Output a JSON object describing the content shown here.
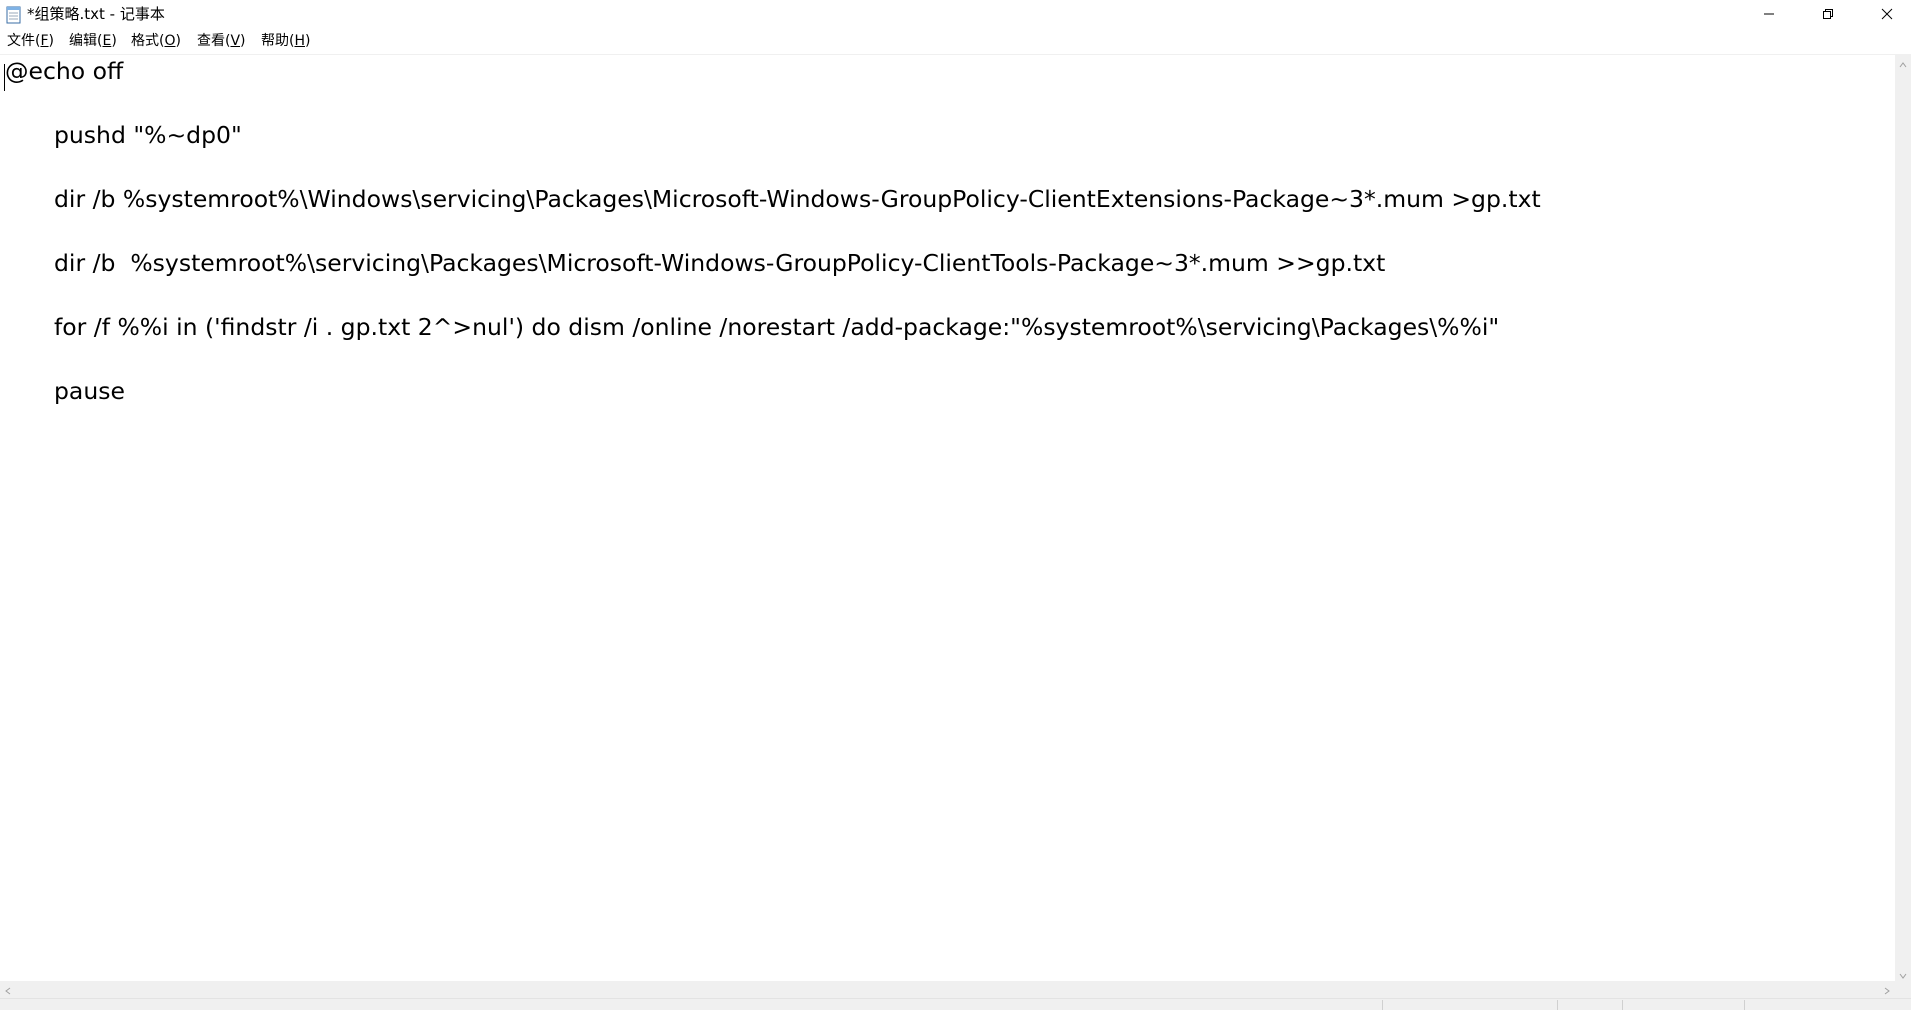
{
  "window": {
    "title": "*组策略.txt - 记事本"
  },
  "menu": [
    {
      "label": "文件(",
      "accel": "F",
      "suffix": ")"
    },
    {
      "label": "编辑(",
      "accel": "E",
      "suffix": ")"
    },
    {
      "label": "格式(",
      "accel": "O",
      "suffix": ")"
    },
    {
      "label": "查看(",
      "accel": "V",
      "suffix": ")"
    },
    {
      "label": "帮助(",
      "accel": "H",
      "suffix": ")"
    }
  ],
  "editor": {
    "lines": [
      "@echo off",
      "pushd \"%~dp0\"",
      "dir /b %systemroot%\\Windows\\servicing\\Packages\\Microsoft-Windows-GroupPolicy-ClientExtensions-Package~3*.mum >gp.txt",
      "dir /b  %systemroot%\\servicing\\Packages\\Microsoft-Windows-GroupPolicy-ClientTools-Package~3*.mum >>gp.txt",
      "for /f %%i in ('findstr /i . gp.txt 2^>nul') do dism /online /norestart /add-package:\"%systemroot%\\servicing\\Packages\\%%i\"",
      "pause"
    ]
  },
  "icons": {
    "app": "notepad-icon",
    "minimize": "minimize-icon",
    "restore": "restore-icon",
    "close": "close-icon"
  }
}
